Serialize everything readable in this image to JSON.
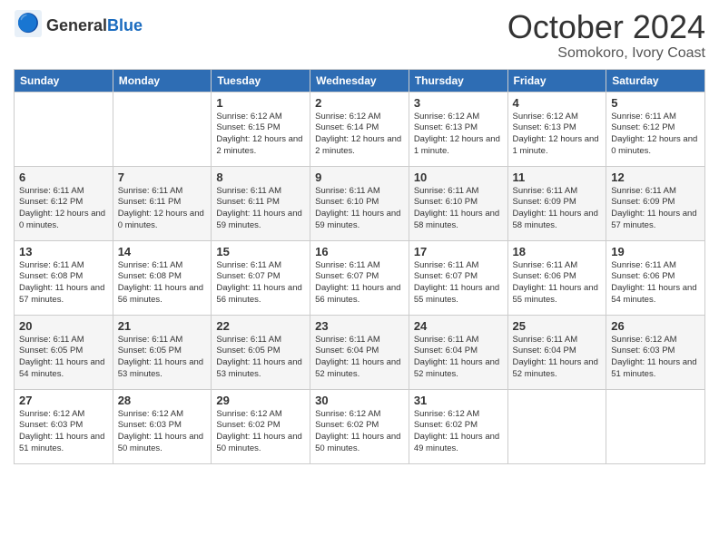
{
  "header": {
    "logo_general": "General",
    "logo_blue": "Blue",
    "month_title": "October 2024",
    "location": "Somokoro, Ivory Coast"
  },
  "days_of_week": [
    "Sunday",
    "Monday",
    "Tuesday",
    "Wednesday",
    "Thursday",
    "Friday",
    "Saturday"
  ],
  "weeks": [
    [
      {
        "day": "",
        "sunrise": "",
        "sunset": "",
        "daylight": ""
      },
      {
        "day": "",
        "sunrise": "",
        "sunset": "",
        "daylight": ""
      },
      {
        "day": "1",
        "sunrise": "Sunrise: 6:12 AM",
        "sunset": "Sunset: 6:15 PM",
        "daylight": "Daylight: 12 hours and 2 minutes."
      },
      {
        "day": "2",
        "sunrise": "Sunrise: 6:12 AM",
        "sunset": "Sunset: 6:14 PM",
        "daylight": "Daylight: 12 hours and 2 minutes."
      },
      {
        "day": "3",
        "sunrise": "Sunrise: 6:12 AM",
        "sunset": "Sunset: 6:13 PM",
        "daylight": "Daylight: 12 hours and 1 minute."
      },
      {
        "day": "4",
        "sunrise": "Sunrise: 6:12 AM",
        "sunset": "Sunset: 6:13 PM",
        "daylight": "Daylight: 12 hours and 1 minute."
      },
      {
        "day": "5",
        "sunrise": "Sunrise: 6:11 AM",
        "sunset": "Sunset: 6:12 PM",
        "daylight": "Daylight: 12 hours and 0 minutes."
      }
    ],
    [
      {
        "day": "6",
        "sunrise": "Sunrise: 6:11 AM",
        "sunset": "Sunset: 6:12 PM",
        "daylight": "Daylight: 12 hours and 0 minutes."
      },
      {
        "day": "7",
        "sunrise": "Sunrise: 6:11 AM",
        "sunset": "Sunset: 6:11 PM",
        "daylight": "Daylight: 12 hours and 0 minutes."
      },
      {
        "day": "8",
        "sunrise": "Sunrise: 6:11 AM",
        "sunset": "Sunset: 6:11 PM",
        "daylight": "Daylight: 11 hours and 59 minutes."
      },
      {
        "day": "9",
        "sunrise": "Sunrise: 6:11 AM",
        "sunset": "Sunset: 6:10 PM",
        "daylight": "Daylight: 11 hours and 59 minutes."
      },
      {
        "day": "10",
        "sunrise": "Sunrise: 6:11 AM",
        "sunset": "Sunset: 6:10 PM",
        "daylight": "Daylight: 11 hours and 58 minutes."
      },
      {
        "day": "11",
        "sunrise": "Sunrise: 6:11 AM",
        "sunset": "Sunset: 6:09 PM",
        "daylight": "Daylight: 11 hours and 58 minutes."
      },
      {
        "day": "12",
        "sunrise": "Sunrise: 6:11 AM",
        "sunset": "Sunset: 6:09 PM",
        "daylight": "Daylight: 11 hours and 57 minutes."
      }
    ],
    [
      {
        "day": "13",
        "sunrise": "Sunrise: 6:11 AM",
        "sunset": "Sunset: 6:08 PM",
        "daylight": "Daylight: 11 hours and 57 minutes."
      },
      {
        "day": "14",
        "sunrise": "Sunrise: 6:11 AM",
        "sunset": "Sunset: 6:08 PM",
        "daylight": "Daylight: 11 hours and 56 minutes."
      },
      {
        "day": "15",
        "sunrise": "Sunrise: 6:11 AM",
        "sunset": "Sunset: 6:07 PM",
        "daylight": "Daylight: 11 hours and 56 minutes."
      },
      {
        "day": "16",
        "sunrise": "Sunrise: 6:11 AM",
        "sunset": "Sunset: 6:07 PM",
        "daylight": "Daylight: 11 hours and 56 minutes."
      },
      {
        "day": "17",
        "sunrise": "Sunrise: 6:11 AM",
        "sunset": "Sunset: 6:07 PM",
        "daylight": "Daylight: 11 hours and 55 minutes."
      },
      {
        "day": "18",
        "sunrise": "Sunrise: 6:11 AM",
        "sunset": "Sunset: 6:06 PM",
        "daylight": "Daylight: 11 hours and 55 minutes."
      },
      {
        "day": "19",
        "sunrise": "Sunrise: 6:11 AM",
        "sunset": "Sunset: 6:06 PM",
        "daylight": "Daylight: 11 hours and 54 minutes."
      }
    ],
    [
      {
        "day": "20",
        "sunrise": "Sunrise: 6:11 AM",
        "sunset": "Sunset: 6:05 PM",
        "daylight": "Daylight: 11 hours and 54 minutes."
      },
      {
        "day": "21",
        "sunrise": "Sunrise: 6:11 AM",
        "sunset": "Sunset: 6:05 PM",
        "daylight": "Daylight: 11 hours and 53 minutes."
      },
      {
        "day": "22",
        "sunrise": "Sunrise: 6:11 AM",
        "sunset": "Sunset: 6:05 PM",
        "daylight": "Daylight: 11 hours and 53 minutes."
      },
      {
        "day": "23",
        "sunrise": "Sunrise: 6:11 AM",
        "sunset": "Sunset: 6:04 PM",
        "daylight": "Daylight: 11 hours and 52 minutes."
      },
      {
        "day": "24",
        "sunrise": "Sunrise: 6:11 AM",
        "sunset": "Sunset: 6:04 PM",
        "daylight": "Daylight: 11 hours and 52 minutes."
      },
      {
        "day": "25",
        "sunrise": "Sunrise: 6:11 AM",
        "sunset": "Sunset: 6:04 PM",
        "daylight": "Daylight: 11 hours and 52 minutes."
      },
      {
        "day": "26",
        "sunrise": "Sunrise: 6:12 AM",
        "sunset": "Sunset: 6:03 PM",
        "daylight": "Daylight: 11 hours and 51 minutes."
      }
    ],
    [
      {
        "day": "27",
        "sunrise": "Sunrise: 6:12 AM",
        "sunset": "Sunset: 6:03 PM",
        "daylight": "Daylight: 11 hours and 51 minutes."
      },
      {
        "day": "28",
        "sunrise": "Sunrise: 6:12 AM",
        "sunset": "Sunset: 6:03 PM",
        "daylight": "Daylight: 11 hours and 50 minutes."
      },
      {
        "day": "29",
        "sunrise": "Sunrise: 6:12 AM",
        "sunset": "Sunset: 6:02 PM",
        "daylight": "Daylight: 11 hours and 50 minutes."
      },
      {
        "day": "30",
        "sunrise": "Sunrise: 6:12 AM",
        "sunset": "Sunset: 6:02 PM",
        "daylight": "Daylight: 11 hours and 50 minutes."
      },
      {
        "day": "31",
        "sunrise": "Sunrise: 6:12 AM",
        "sunset": "Sunset: 6:02 PM",
        "daylight": "Daylight: 11 hours and 49 minutes."
      },
      {
        "day": "",
        "sunrise": "",
        "sunset": "",
        "daylight": ""
      },
      {
        "day": "",
        "sunrise": "",
        "sunset": "",
        "daylight": ""
      }
    ]
  ]
}
